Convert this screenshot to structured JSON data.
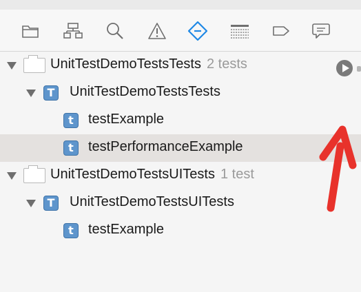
{
  "toolbar": {
    "buttons": [
      {
        "id": "project",
        "icon": "folder-icon",
        "selected": false
      },
      {
        "id": "symbol",
        "icon": "hierarchy-icon",
        "selected": false
      },
      {
        "id": "find",
        "icon": "search-icon",
        "selected": false
      },
      {
        "id": "issue",
        "icon": "warning-icon",
        "selected": false
      },
      {
        "id": "test",
        "icon": "test-diamond-icon",
        "selected": true
      },
      {
        "id": "debug",
        "icon": "list-icon",
        "selected": false
      },
      {
        "id": "breakpoint",
        "icon": "breakpoint-tag-icon",
        "selected": false
      },
      {
        "id": "report",
        "icon": "speech-bubble-icon",
        "selected": false
      }
    ],
    "accent_color": "#1e88e5"
  },
  "tree": {
    "bundle1": {
      "name": "UnitTestDemoTestsTests",
      "count": "2 tests"
    },
    "class1": {
      "name": "UnitTestDemoTestsTests",
      "icon_letter": "T"
    },
    "test1": {
      "name": "testExample",
      "icon_letter": "t"
    },
    "test2": {
      "name": "testPerformanceExample",
      "icon_letter": "t"
    },
    "bundle2": {
      "name": "UnitTestDemoTestsUITests",
      "count": "1 test"
    },
    "class2": {
      "name": "UnitTestDemoTestsUITests",
      "icon_letter": "T"
    },
    "test3": {
      "name": "testExample",
      "icon_letter": "t"
    }
  },
  "colors": {
    "selected_row": "#e4e1df",
    "icon_blue": "#5e95cc",
    "annotation_arrow": "#e8322b"
  }
}
